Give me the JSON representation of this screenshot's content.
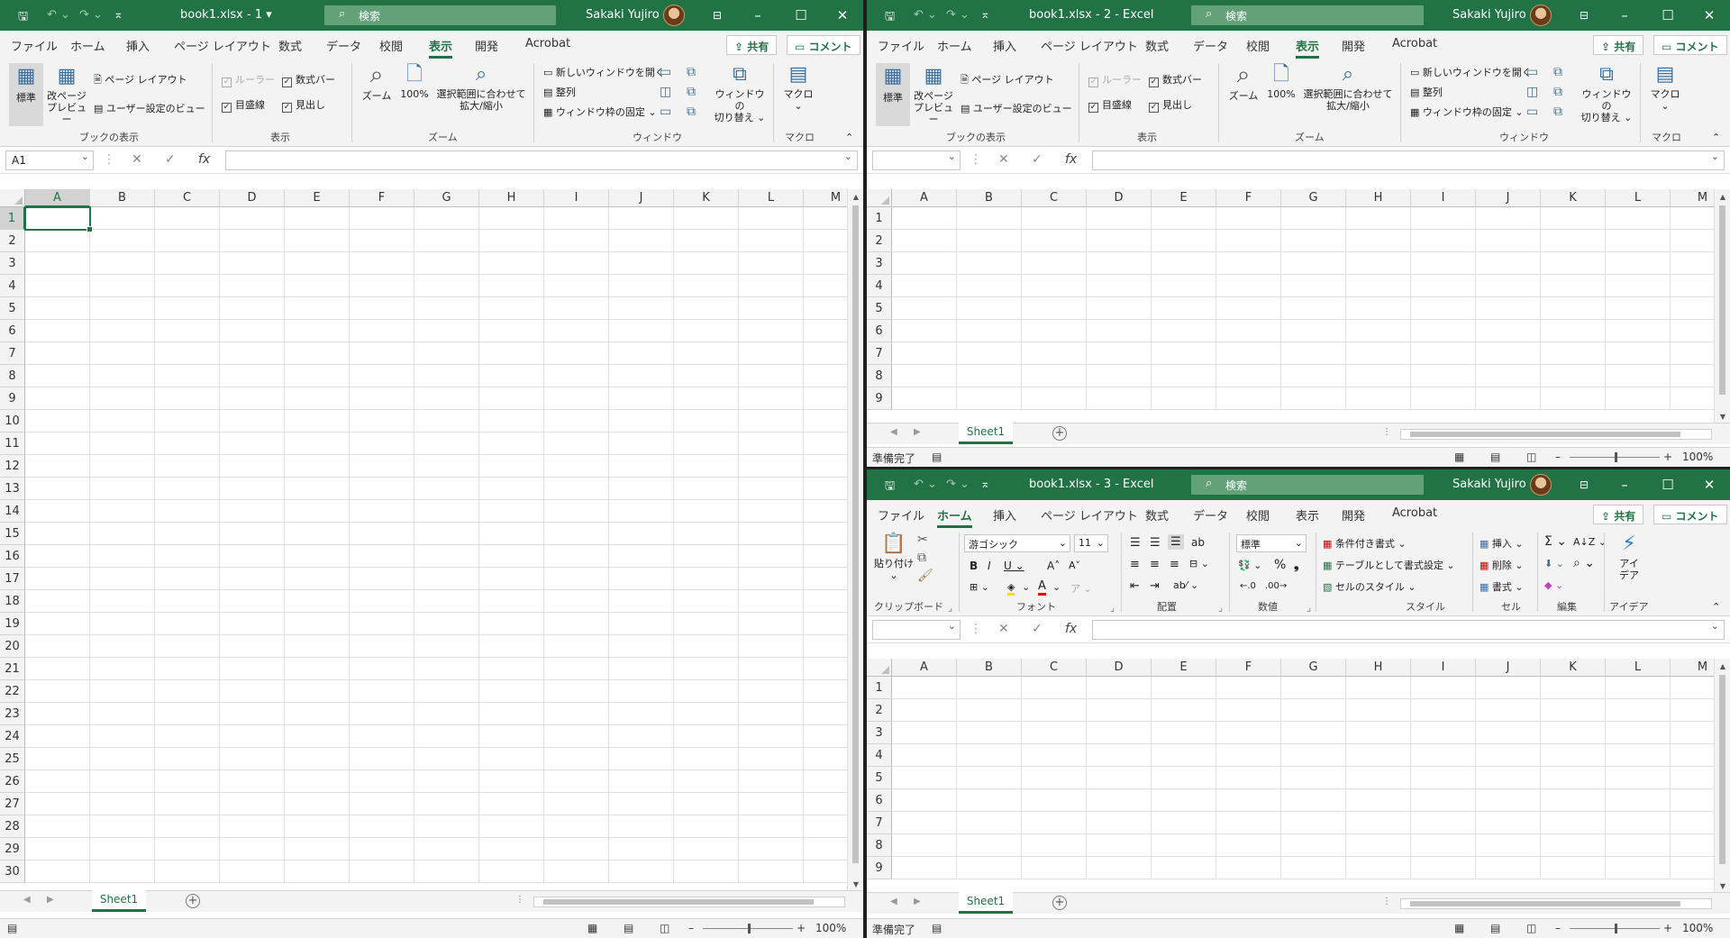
{
  "colors": {
    "accent": "#217346",
    "titlebar_search": "#63a179"
  },
  "columns": [
    "A",
    "B",
    "C",
    "D",
    "E",
    "F",
    "G",
    "H",
    "I",
    "J",
    "K",
    "L",
    "M"
  ],
  "rows_left": [
    "1",
    "2",
    "3",
    "4",
    "5",
    "6",
    "7",
    "8",
    "9",
    "10",
    "11",
    "12",
    "13",
    "14",
    "15",
    "16",
    "17",
    "18",
    "19",
    "20",
    "21",
    "22",
    "23",
    "24",
    "25",
    "26",
    "27",
    "28",
    "29",
    "30"
  ],
  "rows_right": [
    "1",
    "2",
    "3",
    "4",
    "5",
    "6",
    "7",
    "8",
    "9"
  ],
  "search_label": "検索",
  "user": "Sakaki Yujiro",
  "share": "共有",
  "comment": "コメント",
  "sheet_name": "Sheet1",
  "zoom": "100%",
  "status_ready": "準備完了",
  "tabs": [
    "ファイル",
    "ホーム",
    "挿入",
    "ページ レイアウト",
    "数式",
    "データ",
    "校閲",
    "表示",
    "開発",
    "Acrobat"
  ],
  "win1": {
    "title": "book1.xlsx  -  1  ▾",
    "namebox": "A1"
  },
  "win2": {
    "title": "book1.xlsx  -  2  -  Excel"
  },
  "win3": {
    "title": "book1.xlsx  -  3  -  Excel"
  },
  "view_ribbon": {
    "normal": "標準",
    "pagebreak": "改ページ\nプレビュー",
    "page_layout": "ページ レイアウト",
    "custom_view": "ユーザー設定のビュー",
    "ruler": "ルーラー",
    "formula_bar": "数式バー",
    "gridlines": "目盛線",
    "headings": "見出し",
    "zoom": "ズーム",
    "zoom100": "100%",
    "zoom_sel": "選択範囲に合わせて\n拡大/縮小",
    "new_window": "新しいウィンドウを開く",
    "arrange": "整列",
    "freeze": "ウィンドウ枠の固定 ⌄",
    "switch_windows": "ウィンドウの\n切り替え ⌄",
    "macro": "マクロ\n⌄",
    "g_book_view": "ブックの表示",
    "g_show": "表示",
    "g_zoom": "ズーム",
    "g_window": "ウィンドウ",
    "g_macro": "マクロ"
  },
  "home_ribbon": {
    "paste": "貼り付け\n⌄",
    "font_name": "游ゴシック",
    "font_size": "11",
    "number_format": "標準",
    "cond_format": "条件付き書式 ⌄",
    "table_format": "テーブルとして書式設定 ⌄",
    "cell_style": "セルのスタイル ⌄",
    "insert": "挿入 ⌄",
    "delete": "削除 ⌄",
    "format": "書式 ⌄",
    "ideas": "アイ\nデア",
    "g_clipboard": "クリップボード",
    "g_font": "フォント",
    "g_align": "配置",
    "g_number": "数値",
    "g_style": "スタイル",
    "g_cells": "セル",
    "g_edit": "編集",
    "g_ideas": "アイデア"
  }
}
